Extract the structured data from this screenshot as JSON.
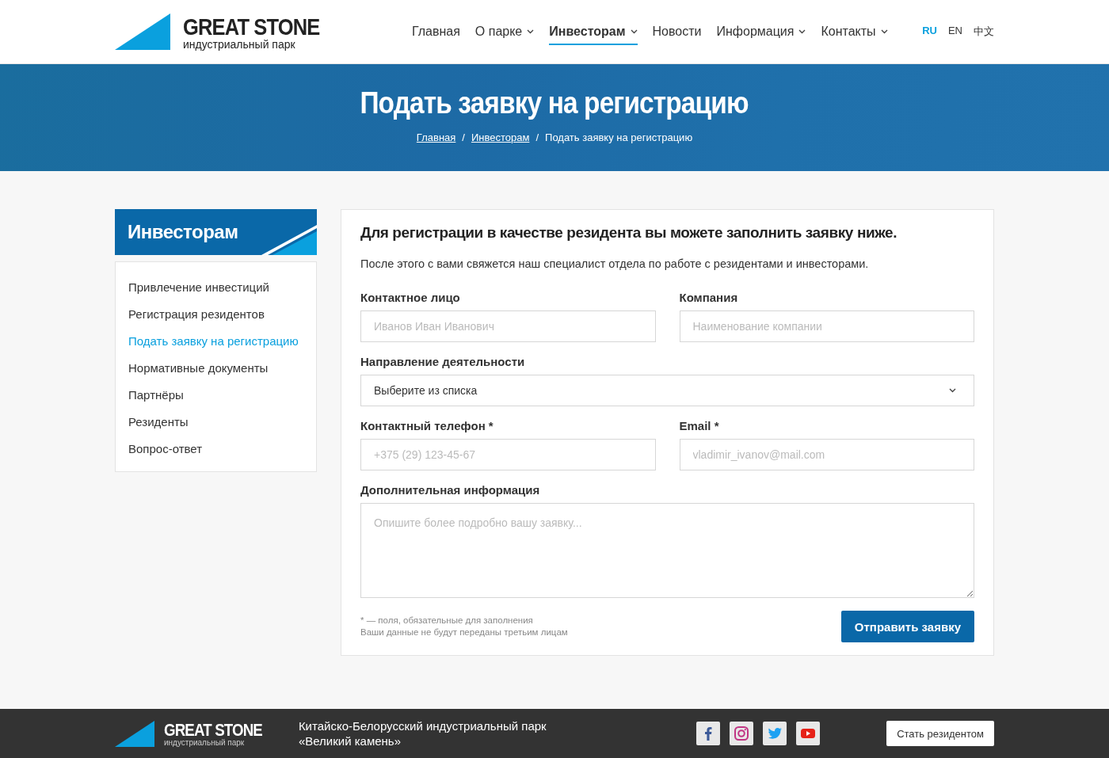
{
  "header": {
    "logo": {
      "title": "GREAT STONE",
      "subtitle": "индустриальный парк"
    },
    "nav": [
      {
        "label": "Главная",
        "dropdown": false,
        "selected": false
      },
      {
        "label": "О парке",
        "dropdown": true,
        "selected": false
      },
      {
        "label": "Инвесторам",
        "dropdown": true,
        "selected": true
      },
      {
        "label": "Новости",
        "dropdown": false,
        "selected": false
      },
      {
        "label": "Информация",
        "dropdown": true,
        "selected": false
      },
      {
        "label": "Контакты",
        "dropdown": true,
        "selected": false
      }
    ],
    "languages": [
      {
        "label": "RU",
        "selected": true
      },
      {
        "label": "EN",
        "selected": false
      },
      {
        "label": "中文",
        "selected": false
      }
    ]
  },
  "hero": {
    "title": "Подать заявку на регистрацию",
    "separator": "/",
    "breadcrumbs": [
      {
        "label": "Главная",
        "link": true
      },
      {
        "label": "Инвесторам",
        "link": true
      },
      {
        "label": "Подать заявку на регистрацию",
        "link": false
      }
    ]
  },
  "sidebar": {
    "title": "Инвесторам",
    "items": [
      {
        "label": "Привлечение инвестиций",
        "selected": false
      },
      {
        "label": "Регистрация резидентов",
        "selected": false
      },
      {
        "label": "Подать заявку на регистрацию",
        "selected": true
      },
      {
        "label": "Нормативные документы",
        "selected": false
      },
      {
        "label": "Партнёры",
        "selected": false
      },
      {
        "label": "Резиденты",
        "selected": false
      },
      {
        "label": "Вопрос-ответ",
        "selected": false
      }
    ]
  },
  "form": {
    "heading": "Для регистрации в качестве резидента вы можете заполнить заявку ниже.",
    "intro": "После этого с вами свяжется наш специалист отдела по работе с резидентами и инвесторами.",
    "rows": [
      [
        {
          "kind": "input",
          "label": "Контактное лицо",
          "placeholder": "Иванов Иван Иванович"
        },
        {
          "kind": "input",
          "label": "Компания",
          "placeholder": "Наименование компании"
        }
      ],
      [
        {
          "kind": "select",
          "label": "Направление деятельности",
          "value": "Выберите из списка"
        }
      ],
      [
        {
          "kind": "input",
          "label": "Контактный телефон *",
          "placeholder": "+375 (29) 123-45-67"
        },
        {
          "kind": "input",
          "label": "Email *",
          "placeholder": "vladimir_ivanov@mail.com"
        }
      ],
      [
        {
          "kind": "textarea",
          "label": "Дополнительная информация",
          "placeholder": "Опишите более подробно вашу заявку..."
        }
      ]
    ],
    "notes": [
      "* — поля, обязательные для заполнения",
      "Ваши данные не будут переданы третьим лицам"
    ],
    "submit": "Отправить заявку"
  },
  "footer": {
    "logo": {
      "title": "GREAT STONE",
      "subtitle": "индустриальный парк"
    },
    "text": [
      "Китайско-Белорусский индустриальный парк",
      "«Великий камень»"
    ],
    "social": [
      {
        "kind": "facebook"
      },
      {
        "kind": "instagram"
      },
      {
        "kind": "twitter"
      },
      {
        "kind": "youtube"
      }
    ],
    "button": "Стать резидентом"
  }
}
